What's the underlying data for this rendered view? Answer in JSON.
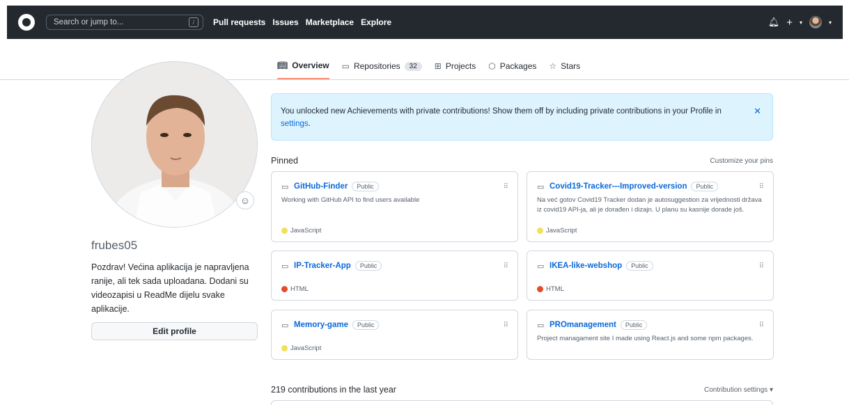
{
  "header": {
    "search_placeholder": "Search or jump to...",
    "search_shortcut": "/",
    "nav": [
      "Pull requests",
      "Issues",
      "Marketplace",
      "Explore"
    ]
  },
  "tabs": [
    {
      "label": "Overview",
      "icon": "book-icon",
      "active": true
    },
    {
      "label": "Repositories",
      "icon": "repo-icon",
      "count": "32"
    },
    {
      "label": "Projects",
      "icon": "table-icon"
    },
    {
      "label": "Packages",
      "icon": "package-icon"
    },
    {
      "label": "Stars",
      "icon": "star-icon"
    }
  ],
  "profile": {
    "username": "frubes05",
    "bio": "Pozdrav! Većina aplikacija je napravljena ranije, ali tek sada uploadana. Dodani su videozapisi u ReadMe dijelu svake aplikacije.",
    "edit_label": "Edit profile"
  },
  "banner": {
    "text": "You unlocked new Achievements with private contributions! Show them off by including private contributions in your Profile in ",
    "link": "settings",
    "end": "."
  },
  "pinned": {
    "title": "Pinned",
    "customize": "Customize your pins",
    "repos": [
      {
        "name": "GitHub-Finder",
        "visibility": "Public",
        "description": "Working with GitHub API to find users available",
        "language": "JavaScript",
        "lang_color": "#f1e05a"
      },
      {
        "name": "Covid19-Tracker---Improved-version",
        "visibility": "Public",
        "description": "Na već gotov Covid19 Tracker dodan je autosuggestion za vrijednosti država iz covid19 API-ja, ali je dorađen i dizajn. U planu su kasnije dorade još.",
        "language": "JavaScript",
        "lang_color": "#f1e05a"
      },
      {
        "name": "IP-Tracker-App",
        "visibility": "Public",
        "description": "",
        "language": "HTML",
        "lang_color": "#e34c26"
      },
      {
        "name": "IKEA-like-webshop",
        "visibility": "Public",
        "description": "",
        "language": "HTML",
        "lang_color": "#e34c26"
      },
      {
        "name": "Memory-game",
        "visibility": "Public",
        "description": "",
        "language": "JavaScript",
        "lang_color": "#f1e05a"
      },
      {
        "name": "PROmanagement",
        "visibility": "Public",
        "description": "Project managament site I made using React.js and some npm packages.",
        "language": "",
        "lang_color": ""
      }
    ]
  },
  "contributions": {
    "title": "219 contributions in the last year",
    "settings": "Contribution settings"
  },
  "colors": {
    "topbar": "#24292f",
    "link": "#0969da",
    "active_tab": "#fd8c73"
  }
}
